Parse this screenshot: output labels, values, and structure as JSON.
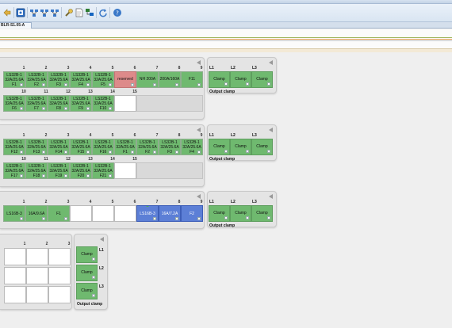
{
  "toolbar": {
    "icons": [
      "back-icon",
      "window-icon",
      "network-icon",
      "network-add-icon",
      "network-remove-icon",
      "wrench-icon",
      "document-icon",
      "network-settings-icon",
      "refresh-icon",
      "help-icon"
    ]
  },
  "tab": {
    "label": "BLR-S1.05-A"
  },
  "rows_section1": {
    "numbers": [
      "1",
      "2",
      "3",
      "4",
      "5",
      "6",
      "7",
      "8",
      "9"
    ],
    "row1": [
      {
        "l1": "LS32B-1",
        "l2": "32A/25.6A",
        "l3": "F1"
      },
      {
        "l1": "LS32B-1",
        "l2": "32A/25.6A",
        "l3": "F2"
      },
      {
        "l1": "LS32B-1",
        "l2": "32A/25.6A",
        "l3": "F3"
      },
      {
        "l1": "LS32B-1",
        "l2": "32A/25.6A",
        "l3": "F4"
      },
      {
        "l1": "LS32B-1",
        "l2": "32A/25.6A",
        "l3": "F5"
      },
      {
        "l1": "reserved",
        "l2": "",
        "l3": ""
      },
      {
        "l1": "NH 200A",
        "l2": "",
        "l3": ""
      },
      {
        "l1": "200A/160A",
        "l2": "",
        "l3": ""
      },
      {
        "l1": "F11",
        "l2": "",
        "l3": ""
      }
    ],
    "numbers2": [
      "10",
      "11",
      "12",
      "13",
      "14",
      "15"
    ],
    "row2": [
      {
        "l1": "LS32B-1",
        "l2": "32A/25.6A",
        "l3": "F6"
      },
      {
        "l1": "LS32B-1",
        "l2": "32A/25.6A",
        "l3": "F7"
      },
      {
        "l1": "LS32B-1",
        "l2": "32A/25.6A",
        "l3": "F8"
      },
      {
        "l1": "LS32B-1",
        "l2": "32A/25.6A",
        "l3": "F9"
      },
      {
        "l1": "LS32B-1",
        "l2": "32A/25.6A",
        "l3": "F10"
      }
    ]
  },
  "rows_section2": {
    "numbers": [
      "1",
      "2",
      "3",
      "4",
      "5",
      "6",
      "7",
      "8",
      "9"
    ],
    "row1": [
      {
        "l1": "LS32B-1",
        "l2": "32A/25.6A",
        "l3": "F12"
      },
      {
        "l1": "LS32B-1",
        "l2": "32A/25.6A",
        "l3": "F13"
      },
      {
        "l1": "LS32B-1",
        "l2": "32A/25.6A",
        "l3": "F14"
      },
      {
        "l1": "LS32B-1",
        "l2": "32A/25.6A",
        "l3": "F15"
      },
      {
        "l1": "LS32B-1",
        "l2": "32A/25.6A",
        "l3": "F16"
      },
      {
        "l1": "LS32B-1",
        "l2": "32A/25.6A",
        "l3": "F1"
      },
      {
        "l1": "LS32B-1",
        "l2": "32A/25.6A",
        "l3": "F2"
      },
      {
        "l1": "LS32B-1",
        "l2": "32A/25.6A",
        "l3": "F3"
      },
      {
        "l1": "LS32B-1",
        "l2": "32A/25.6A",
        "l3": "F4"
      }
    ],
    "numbers2": [
      "10",
      "11",
      "12",
      "13",
      "14",
      "15"
    ],
    "row2": [
      {
        "l1": "LS32B-1",
        "l2": "32A/25.6A",
        "l3": "F17"
      },
      {
        "l1": "LS32B-1",
        "l2": "32A/25.6A",
        "l3": "F18"
      },
      {
        "l1": "LS32B-1",
        "l2": "32A/25.6A",
        "l3": "F19"
      },
      {
        "l1": "LS32B-1",
        "l2": "32A/25.6A",
        "l3": "F20"
      },
      {
        "l1": "LS32B-1",
        "l2": "32A/25.6A",
        "l3": "F21"
      }
    ]
  },
  "rows_section3": {
    "numbers": [
      "1",
      "2",
      "3",
      "4",
      "5",
      "6",
      "7",
      "8",
      "9"
    ],
    "cells": [
      {
        "text": "LS16B-3"
      },
      {
        "text": "16A/9.6A"
      },
      {
        "text": "F1"
      },
      {
        "text": "LS16B-3"
      },
      {
        "text": "16A/7.2A"
      },
      {
        "text": "F2"
      }
    ]
  },
  "section4": {
    "numbers": [
      "1",
      "2",
      "3"
    ]
  },
  "output": {
    "labels": [
      "L1",
      "L2",
      "L3"
    ],
    "clamp": "Clamp",
    "caption": "Output clamp"
  },
  "colors": {
    "green": "#6fb96f",
    "red": "#dd8a8a",
    "blue": "#5c7fd6"
  }
}
